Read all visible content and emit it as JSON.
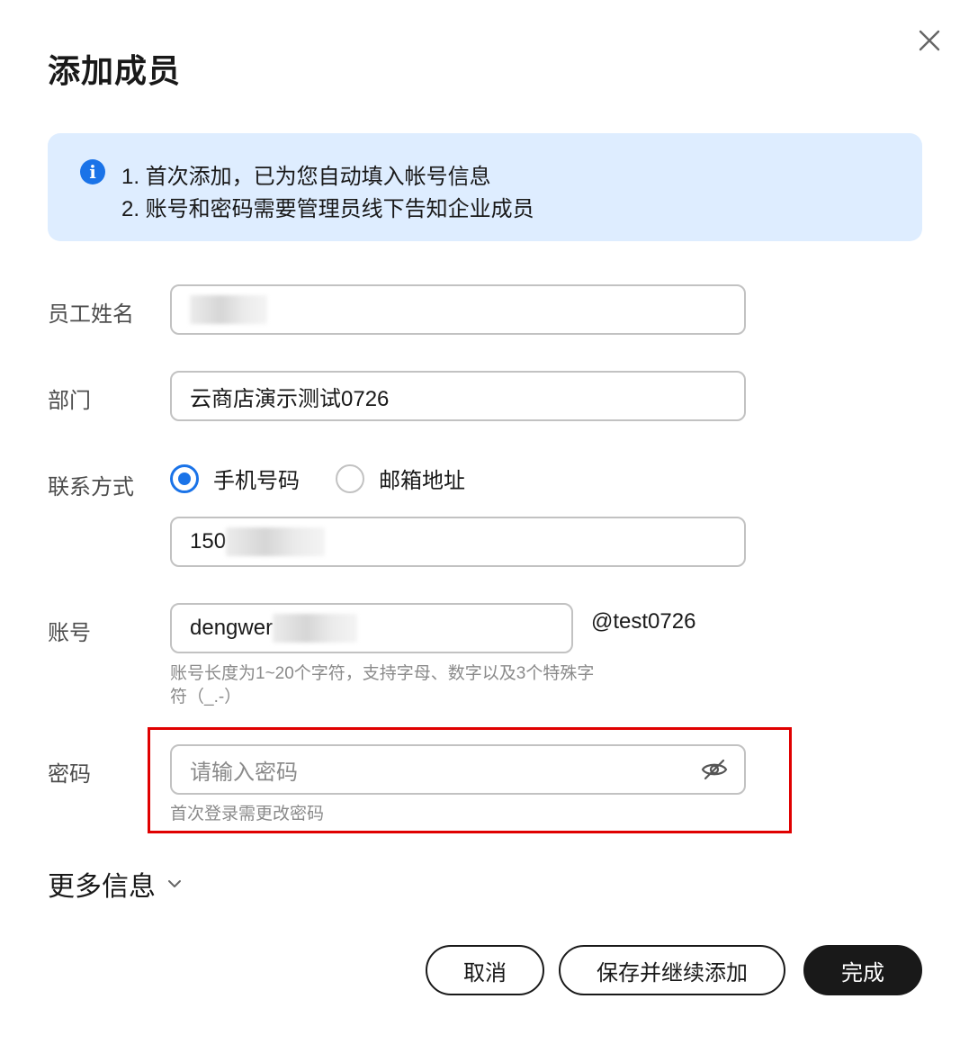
{
  "dialog": {
    "title": "添加成员",
    "close_icon": "close-icon"
  },
  "notice": {
    "icon": "info-icon",
    "icon_glyph": "i",
    "line1": "1. 首次添加，已为您自动填入帐号信息",
    "line2": "2. 账号和密码需要管理员线下告知企业成员"
  },
  "form": {
    "name": {
      "label": "员工姓名",
      "value": ""
    },
    "department": {
      "label": "部门",
      "value": "云商店演示测试0726"
    },
    "contact": {
      "label": "联系方式",
      "options": [
        {
          "label": "手机号码",
          "selected": true
        },
        {
          "label": "邮箱地址",
          "selected": false
        }
      ],
      "value": "150"
    },
    "account": {
      "label": "账号",
      "value": "dengwer",
      "suffix": "@test0726",
      "hint_line1": "账号长度为1~20个字符，支持字母、数字以及3个特殊字",
      "hint_line2": "符（_.-）"
    },
    "password": {
      "label": "密码",
      "placeholder": "请输入密码",
      "icon": "eye-off-icon",
      "hint": "首次登录需更改密码"
    }
  },
  "more": {
    "label": "更多信息",
    "icon": "chevron-down-icon"
  },
  "footer": {
    "cancel_label": "取消",
    "save_continue_label": "保存并继续添加",
    "done_label": "完成"
  },
  "colors": {
    "accent": "#1a73e8",
    "notice_bg": "#deedff",
    "highlight": "#e00000",
    "primary_button": "#191919"
  }
}
